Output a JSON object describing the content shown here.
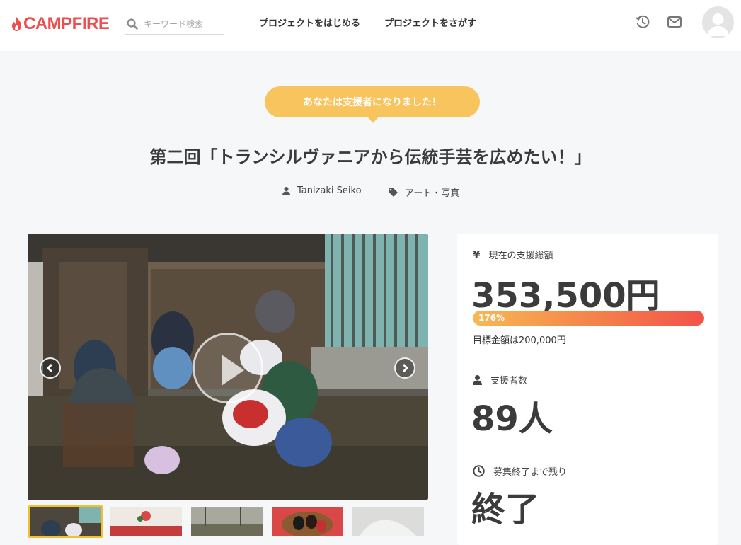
{
  "header": {
    "logo_text": "CAMPFIRE",
    "search_placeholder": "キーワード検索",
    "nav": [
      "プロジェクトをはじめる",
      "プロジェクトをさがす"
    ],
    "icons": [
      "history-icon",
      "mail-icon",
      "avatar"
    ]
  },
  "hero": {
    "badge": "あなたは支援者になりました！",
    "title": "第二回「トランシルヴァニアから伝統手芸を広めたい！」",
    "author": "Tanizaki Seiko",
    "category": "アート・写真"
  },
  "media": {
    "thumbnail_count": 5,
    "active_thumbnail": 1
  },
  "stats": {
    "total_label": "現在の支援総額",
    "total_value": "353,500円",
    "progress_text": "176%",
    "progress_percent": 176,
    "goal_text": "目標金額は200,000円",
    "backers_label": "支援者数",
    "backers_value": "89人",
    "remaining_label": "募集終了まで残り",
    "remaining_value": "終了"
  },
  "colors": {
    "brand": "#ee4e4e",
    "badge": "#f8c45d",
    "progress_start": "#f7b954",
    "progress_end": "#f2524a"
  }
}
